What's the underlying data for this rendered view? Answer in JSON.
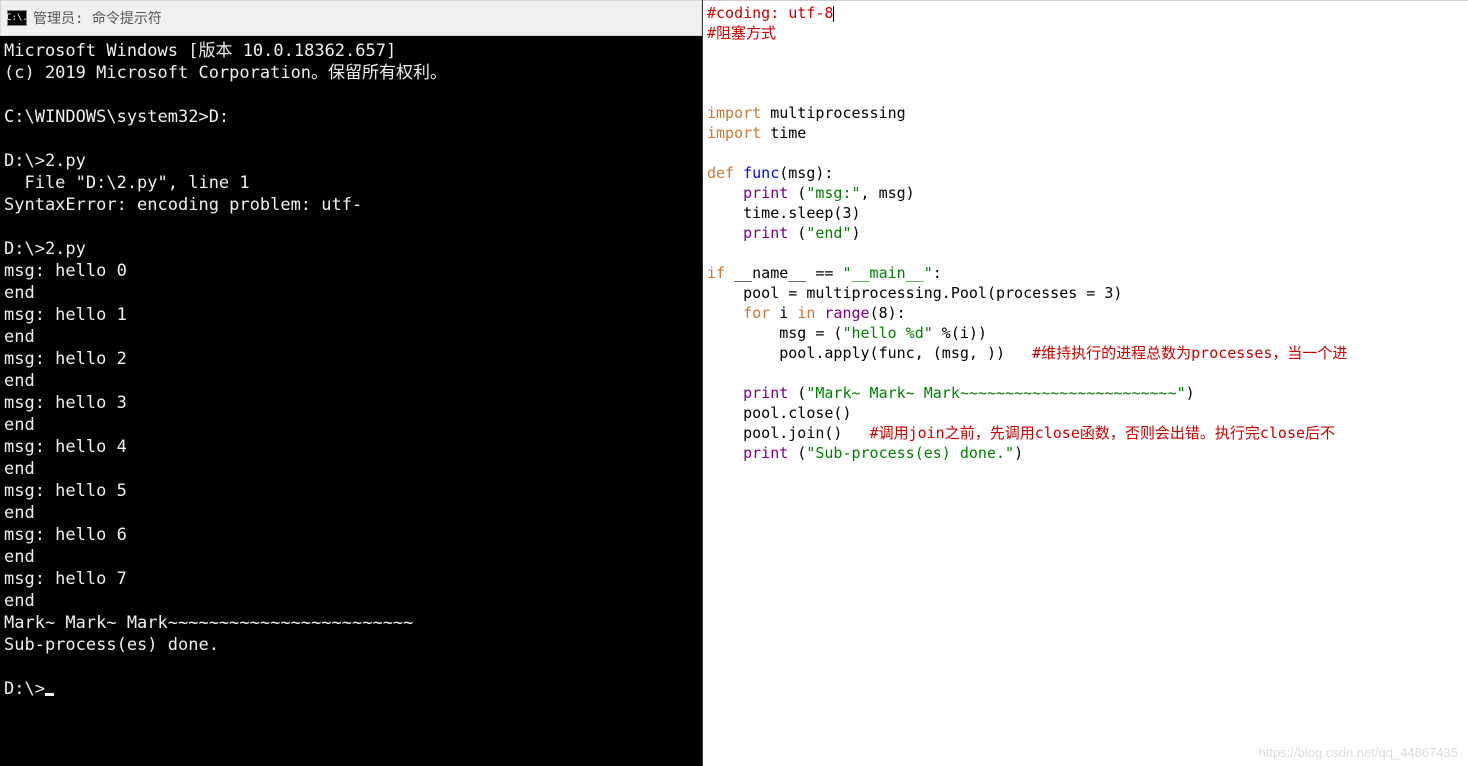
{
  "titlebar": {
    "icon_text": "C:\\.",
    "title": "管理员: 命令提示符"
  },
  "console": {
    "lines": [
      "Microsoft Windows [版本 10.0.18362.657]",
      "(c) 2019 Microsoft Corporation。保留所有权利。",
      "",
      "C:\\WINDOWS\\system32>D:",
      "",
      "D:\\>2.py",
      "  File \"D:\\2.py\", line 1",
      "SyntaxError: encoding problem: utf-",
      "",
      "D:\\>2.py",
      "msg: hello 0",
      "end",
      "msg: hello 1",
      "end",
      "msg: hello 2",
      "end",
      "msg: hello 3",
      "end",
      "msg: hello 4",
      "end",
      "msg: hello 5",
      "end",
      "msg: hello 6",
      "end",
      "msg: hello 7",
      "end",
      "Mark~ Mark~ Mark~~~~~~~~~~~~~~~~~~~~~~~~",
      "Sub-process(es) done.",
      "",
      "D:\\>"
    ]
  },
  "code": {
    "lines": [
      [
        {
          "cls": "c-red",
          "t": "#coding: utf-8"
        },
        {
          "cls": "cursor-mark",
          "t": ""
        }
      ],
      [
        {
          "cls": "c-red",
          "t": "#阻塞方式"
        }
      ],
      [
        {
          "cls": "",
          "t": ""
        }
      ],
      [
        {
          "cls": "",
          "t": ""
        }
      ],
      [
        {
          "cls": "",
          "t": ""
        }
      ],
      [
        {
          "cls": "c-orange",
          "t": "import"
        },
        {
          "cls": "c-black",
          "t": " multiprocessing"
        }
      ],
      [
        {
          "cls": "c-orange",
          "t": "import"
        },
        {
          "cls": "c-black",
          "t": " time"
        }
      ],
      [
        {
          "cls": "",
          "t": ""
        }
      ],
      [
        {
          "cls": "c-orange",
          "t": "def"
        },
        {
          "cls": "c-black",
          "t": " "
        },
        {
          "cls": "c-blue",
          "t": "func"
        },
        {
          "cls": "c-black",
          "t": "(msg):"
        }
      ],
      [
        {
          "cls": "c-black",
          "t": "    "
        },
        {
          "cls": "c-purple",
          "t": "print"
        },
        {
          "cls": "c-black",
          "t": " ("
        },
        {
          "cls": "c-green",
          "t": "\"msg:\""
        },
        {
          "cls": "c-black",
          "t": ", msg)"
        }
      ],
      [
        {
          "cls": "c-black",
          "t": "    time.sleep("
        },
        {
          "cls": "c-black",
          "t": "3"
        },
        {
          "cls": "c-black",
          "t": ")"
        }
      ],
      [
        {
          "cls": "c-black",
          "t": "    "
        },
        {
          "cls": "c-purple",
          "t": "print"
        },
        {
          "cls": "c-black",
          "t": " ("
        },
        {
          "cls": "c-green",
          "t": "\"end\""
        },
        {
          "cls": "c-black",
          "t": ")"
        }
      ],
      [
        {
          "cls": "",
          "t": ""
        }
      ],
      [
        {
          "cls": "c-orange",
          "t": "if"
        },
        {
          "cls": "c-black",
          "t": " __name__ == "
        },
        {
          "cls": "c-green",
          "t": "\"__main__\""
        },
        {
          "cls": "c-black",
          "t": ":"
        }
      ],
      [
        {
          "cls": "c-black",
          "t": "    pool = multiprocessing.Pool(processes = "
        },
        {
          "cls": "c-black",
          "t": "3"
        },
        {
          "cls": "c-black",
          "t": ")"
        }
      ],
      [
        {
          "cls": "c-black",
          "t": "    "
        },
        {
          "cls": "c-orange",
          "t": "for"
        },
        {
          "cls": "c-black",
          "t": " i "
        },
        {
          "cls": "c-orange",
          "t": "in"
        },
        {
          "cls": "c-black",
          "t": " "
        },
        {
          "cls": "c-purple",
          "t": "range"
        },
        {
          "cls": "c-black",
          "t": "("
        },
        {
          "cls": "c-black",
          "t": "8"
        },
        {
          "cls": "c-black",
          "t": "):"
        }
      ],
      [
        {
          "cls": "c-black",
          "t": "        msg = ("
        },
        {
          "cls": "c-green",
          "t": "\"hello %d\""
        },
        {
          "cls": "c-black",
          "t": " %(i))"
        }
      ],
      [
        {
          "cls": "c-black",
          "t": "        pool.apply(func, (msg, ))   "
        },
        {
          "cls": "c-red",
          "t": "#维持执行的进程总数为processes，当一个进"
        }
      ],
      [
        {
          "cls": "",
          "t": ""
        }
      ],
      [
        {
          "cls": "c-black",
          "t": "    "
        },
        {
          "cls": "c-purple",
          "t": "print"
        },
        {
          "cls": "c-black",
          "t": " ("
        },
        {
          "cls": "c-green",
          "t": "\"Mark~ Mark~ Mark~~~~~~~~~~~~~~~~~~~~~~~~\""
        },
        {
          "cls": "c-black",
          "t": ")"
        }
      ],
      [
        {
          "cls": "c-black",
          "t": "    pool.close()"
        }
      ],
      [
        {
          "cls": "c-black",
          "t": "    pool.join()   "
        },
        {
          "cls": "c-red",
          "t": "#调用join之前，先调用close函数，否则会出错。执行完close后不"
        }
      ],
      [
        {
          "cls": "c-black",
          "t": "    "
        },
        {
          "cls": "c-purple",
          "t": "print"
        },
        {
          "cls": "c-black",
          "t": " ("
        },
        {
          "cls": "c-green",
          "t": "\"Sub-process(es) done.\""
        },
        {
          "cls": "c-black",
          "t": ")"
        }
      ]
    ]
  },
  "watermark": "https://blog.csdn.net/qq_44867435"
}
